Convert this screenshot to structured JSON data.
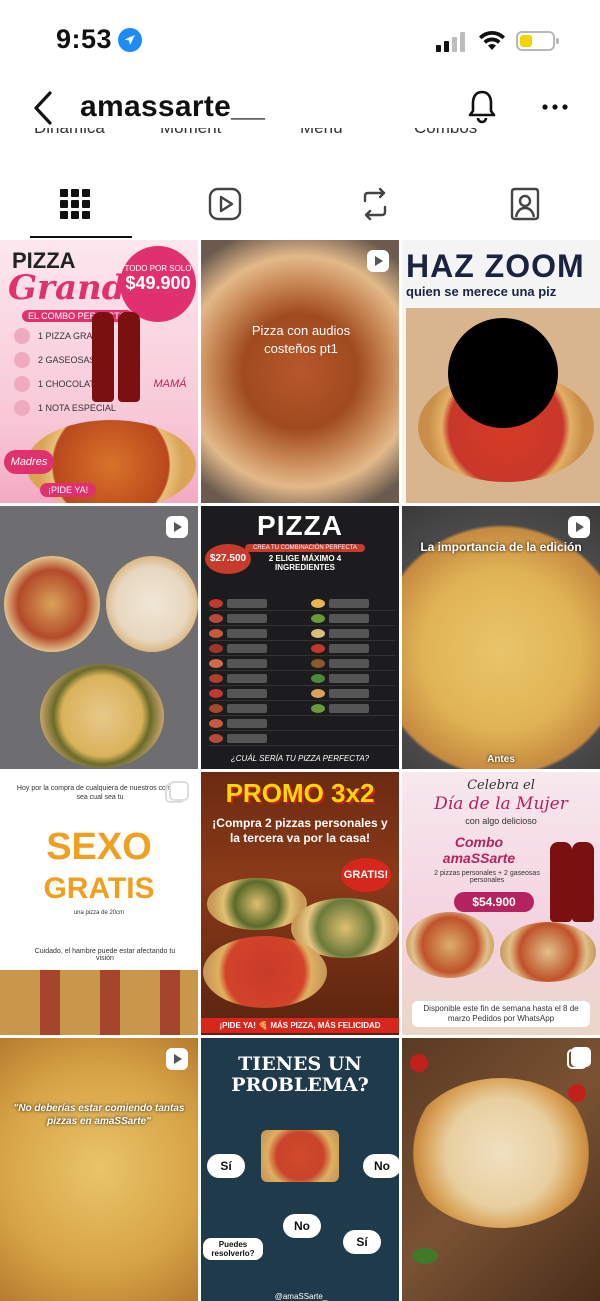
{
  "status_bar": {
    "time": "9:53"
  },
  "header": {
    "username": "amassarte__"
  },
  "highlights_partial": [
    "Dinámica",
    "Moment",
    "Menú",
    "Combos"
  ],
  "tabs": [
    {
      "name": "grid",
      "active": true
    },
    {
      "name": "reels",
      "active": false
    },
    {
      "name": "reposts",
      "active": false
    },
    {
      "name": "tagged",
      "active": false
    }
  ],
  "posts": {
    "p1": {
      "type": "image",
      "pizza": "PIZZA",
      "grande": "Grande",
      "combo": "EL COMBO PERFECTO",
      "badge_top": "TODO POR SOLO",
      "price": "$49.900",
      "items": [
        "1 PIZZA GRANDE",
        "2 GASEOSAS",
        "1 CHOCOLATINA",
        "1 NOTA ESPECIAL"
      ],
      "mama": "MAMÁ",
      "madres": "Madres",
      "cta": "¡PIDE YA!"
    },
    "p2": {
      "type": "reel",
      "caption": "Pizza con audios costeños pt1"
    },
    "p3": {
      "type": "image",
      "title": "HAZ ZOOM",
      "subtitle": "quien se merece una piz"
    },
    "p4": {
      "type": "reel"
    },
    "p5": {
      "type": "image",
      "title": "PIZZA",
      "sub1": "CREA TU COMBINACIÓN PERFECTA",
      "sub2": "2 ELIGE MÁXIMO 4 INGREDIENTES",
      "price": "$27.500",
      "footer": "¿CUÁL SERÍA TU PIZZA PERFECTA?"
    },
    "p6": {
      "type": "reel",
      "caption": "La importancia de la edición",
      "footer": "Antes"
    },
    "p7": {
      "type": "carousel",
      "top": "Hoy por la compra de cualquiera de nuestros combos sea cual sea tu",
      "sexo": "SEXO",
      "gratis": "GRATIS",
      "small": "una pizza de 20cm",
      "warn": "Cuidado, el hambre puede estar afectando tu visión"
    },
    "p8": {
      "type": "image",
      "title": "PROMO 3x2",
      "subtitle": "¡Compra 2 pizzas personales y la tercera va por la casa!",
      "badge": "GRATIS!",
      "footer": "¡PIDE YA! 🍕 MÁS PIZZA, MÁS FELICIDAD"
    },
    "p9": {
      "type": "image",
      "l1": "Celebra el",
      "l2": "Día de la Mujer",
      "l3": "con algo delicioso",
      "combo": "Combo amaSSarte",
      "items": "2 pizzas personales + 2 gaseosas personales",
      "price": "$54.900",
      "footer": "Disponible este fin de semana hasta el 8 de marzo Pedidos por WhatsApp"
    },
    "p10": {
      "type": "reel",
      "caption": "\"No deberías estar comiendo tantas pizzas en amaSSarte\""
    },
    "p11": {
      "type": "image",
      "title": "TIENES UN PROBLEMA?",
      "si": "Sí",
      "no": "No",
      "question": "Puedes resolverlo?",
      "footer": "@amaSSarte_"
    },
    "p12": {
      "type": "carousel"
    }
  },
  "colors": {
    "brand_pink": "#e0316e",
    "menu_red": "#c63b2b",
    "promo_yellow": "#ffd700",
    "sexo_orange": "#f0a020"
  }
}
